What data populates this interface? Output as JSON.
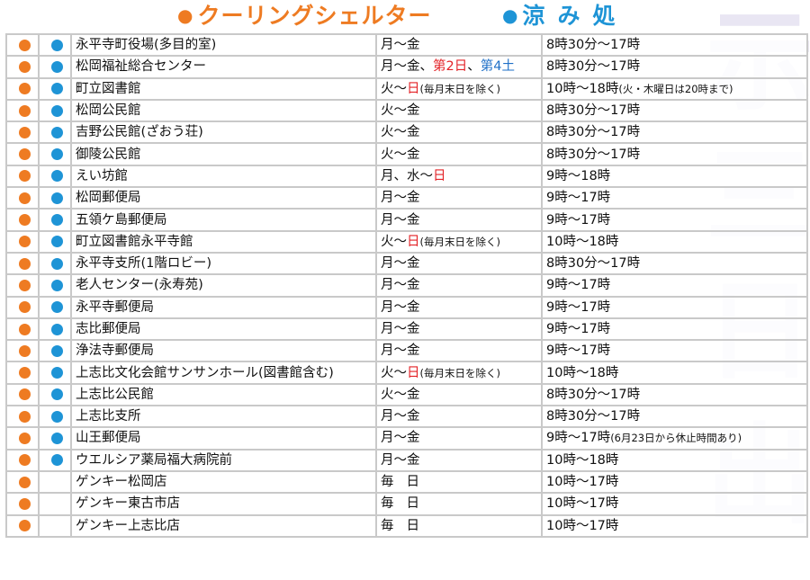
{
  "header": {
    "cooling_label": "クーリングシェルター",
    "suzumi_label": "涼み処",
    "cooling_color": "#ee7b22",
    "suzumi_color": "#1e94d6"
  },
  "side_text": [
    "示",
    "三",
    "日",
    "出"
  ],
  "rows": [
    {
      "cooling": true,
      "suzumi": true,
      "name": "永平寺町役場(多目的室)",
      "days": "月～金",
      "hours": "8時30分～17時"
    },
    {
      "cooling": true,
      "suzumi": true,
      "name": "松岡福祉総合センター",
      "days_parts": [
        "月～金、",
        "第2日",
        "、",
        "第4土"
      ],
      "hours": "8時30分～17時"
    },
    {
      "cooling": true,
      "suzumi": true,
      "name": "町立図書館",
      "days_parts": [
        "火～",
        "日",
        "(毎月末日を除く)"
      ],
      "hours_parts": [
        "10時～18時",
        "(火・木曜日は20時まで)"
      ]
    },
    {
      "cooling": true,
      "suzumi": true,
      "name": "松岡公民館",
      "days": "火～金",
      "hours": "8時30分～17時"
    },
    {
      "cooling": true,
      "suzumi": true,
      "name": "吉野公民館(ざおう荘)",
      "days": "火～金",
      "hours": "8時30分～17時"
    },
    {
      "cooling": true,
      "suzumi": true,
      "name": "御陵公民館",
      "days": "火～金",
      "hours": "8時30分～17時"
    },
    {
      "cooling": true,
      "suzumi": true,
      "name": "えい坊館",
      "days_parts": [
        "月、水～",
        "日",
        ""
      ],
      "hours": "9時～18時"
    },
    {
      "cooling": true,
      "suzumi": true,
      "name": "松岡郵便局",
      "days": "月～金",
      "hours": "9時～17時"
    },
    {
      "cooling": true,
      "suzumi": true,
      "name": "五領ケ島郵便局",
      "days": "月～金",
      "hours": "9時～17時"
    },
    {
      "cooling": true,
      "suzumi": true,
      "name": "町立図書館永平寺館",
      "days_parts": [
        "火～",
        "日",
        "(毎月末日を除く)"
      ],
      "hours": "10時～18時"
    },
    {
      "cooling": true,
      "suzumi": true,
      "name": "永平寺支所(1階ロビー)",
      "days": "月～金",
      "hours": "8時30分～17時"
    },
    {
      "cooling": true,
      "suzumi": true,
      "name": "老人センター(永寿苑)",
      "days": "月～金",
      "hours": "9時～17時"
    },
    {
      "cooling": true,
      "suzumi": true,
      "name": "永平寺郵便局",
      "days": "月～金",
      "hours": "9時～17時"
    },
    {
      "cooling": true,
      "suzumi": true,
      "name": "志比郵便局",
      "days": "月～金",
      "hours": "9時～17時"
    },
    {
      "cooling": true,
      "suzumi": true,
      "name": "浄法寺郵便局",
      "days": "月～金",
      "hours": "9時～17時"
    },
    {
      "cooling": true,
      "suzumi": true,
      "name": "上志比文化会館サンサンホール(図書館含む)",
      "days_parts": [
        "火～",
        "日",
        "(毎月末日を除く)"
      ],
      "hours": "10時～18時"
    },
    {
      "cooling": true,
      "suzumi": true,
      "name": "上志比公民館",
      "days": "火～金",
      "hours": "8時30分～17時"
    },
    {
      "cooling": true,
      "suzumi": true,
      "name": "上志比支所",
      "days": "月～金",
      "hours": "8時30分～17時"
    },
    {
      "cooling": true,
      "suzumi": true,
      "name": "山王郵便局",
      "days": "月～金",
      "hours_parts": [
        "9時～17時",
        "(6月23日から休止時間あり)"
      ]
    },
    {
      "cooling": true,
      "suzumi": true,
      "name": "ウエルシア薬局福大病院前",
      "days": "月～金",
      "hours": "10時～18時"
    },
    {
      "cooling": true,
      "suzumi": false,
      "name": "ゲンキー松岡店",
      "days": "毎日",
      "days_spaced": true,
      "hours": "10時～17時"
    },
    {
      "cooling": true,
      "suzumi": false,
      "name": "ゲンキー東古市店",
      "days": "毎日",
      "days_spaced": true,
      "hours": "10時～17時"
    },
    {
      "cooling": true,
      "suzumi": false,
      "name": "ゲンキー上志比店",
      "days": "毎日",
      "days_spaced": true,
      "hours": "10時～17時"
    }
  ]
}
